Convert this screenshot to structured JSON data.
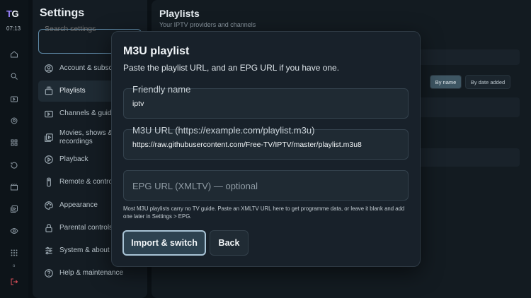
{
  "rail": {
    "logo_t": "T",
    "logo_g": "G",
    "time": "07:13",
    "status_dot": "o",
    "icons": [
      "home-icon",
      "search-icon",
      "tv-guide-icon",
      "sports-icon",
      "grid-icon",
      "history-icon",
      "movies-icon",
      "playlist-play-icon",
      "eye-icon",
      "apps-icon",
      "exit-icon"
    ]
  },
  "settings": {
    "title": "Settings",
    "search_placeholder": "Search settings",
    "items": [
      {
        "label": "Account & subscr",
        "icon": "account-icon"
      },
      {
        "label": "Playlists",
        "icon": "playlists-icon"
      },
      {
        "label": "Channels & guide",
        "icon": "channels-icon"
      },
      {
        "label": "Movies, shows &",
        "label2": "recordings",
        "icon": "movies-shows-icon"
      },
      {
        "label": "Playback",
        "icon": "playback-icon"
      },
      {
        "label": "Remote & control",
        "icon": "remote-icon"
      },
      {
        "label": "Appearance",
        "icon": "palette-icon"
      },
      {
        "label": "Parental controls",
        "icon": "lock-icon"
      },
      {
        "label": "System & about",
        "icon": "sliders-icon"
      },
      {
        "label": "Help & maintenance",
        "icon": "help-icon"
      }
    ]
  },
  "main": {
    "title": "Playlists",
    "subtitle": "Your IPTV providers and channels",
    "sort_by_name": "By name",
    "sort_by_date": "By date added"
  },
  "modal": {
    "title": "M3U playlist",
    "description": "Paste the playlist URL, and an EPG URL if you have one.",
    "friendly_name_label": "Friendly name",
    "friendly_name_value": "iptv",
    "m3u_label": "M3U URL (https://example.com/playlist.m3u)",
    "m3u_value": "https://raw.githubusercontent.com/Free-TV/IPTV/master/playlist.m3u8",
    "epg_placeholder": "EPG URL (XMLTV) — optional",
    "hint": "Most M3U playlists carry no TV guide. Paste an XMLTV URL here to get programme data, or leave it blank and add one later in Settings > EPG.",
    "import_button": "Import & switch",
    "back_button": "Back"
  }
}
